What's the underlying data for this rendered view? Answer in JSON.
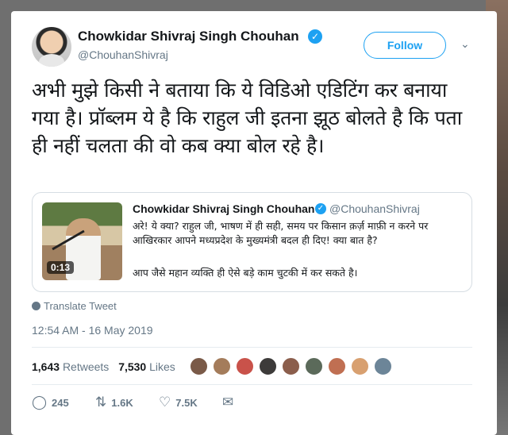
{
  "author": {
    "name": "Chowkidar Shivraj Singh Chouhan",
    "handle": "@ChouhanShivraj"
  },
  "follow_label": "Follow",
  "tweet_text": "अभी मुझे किसी ने बताया कि ये विडिओ एडिटिंग कर बनाया गया है। प्रॉब्लम ये है कि राहुल जी इतना झूठ बोलते है कि पता ही नहीं चलता की वो कब क्या बोल रहे है।",
  "quoted_tweet": {
    "name": "Chowkidar Shivraj Singh Chouhan",
    "handle": "@ChouhanShivraj",
    "text_1": "अरे! ये क्या? राहुल जी, भाषण में ही सही, समय पर किसान क़र्ज़ माफ़ी न करने पर आखिरकार आपने मध्यप्रदेश के मुख्यमंत्री बदल ही दिए! क्या बात है?",
    "text_2": "आप जैसे महान व्यक्ति ही ऐसे बड़े काम चुटकी में कर सकते है।",
    "video_duration": "0:13"
  },
  "translate_label": "Translate Tweet",
  "timestamp": "12:54 AM - 16 May 2019",
  "stats": {
    "retweets": "1,643",
    "retweets_label": "Retweets",
    "likes": "7,530",
    "likes_label": "Likes"
  },
  "actions": {
    "replies": "245",
    "retweets": "1.6K",
    "likes": "7.5K"
  },
  "colors": {
    "accent": "#1da1f2",
    "secondary_text": "#657786",
    "primary_text": "#14171a"
  },
  "icons": {
    "verified": "verified-badge-icon",
    "chevron": "chevron-down-icon",
    "globe": "globe-icon",
    "reply": "reply-icon",
    "retweet": "retweet-icon",
    "like": "heart-icon",
    "message": "envelope-icon"
  }
}
